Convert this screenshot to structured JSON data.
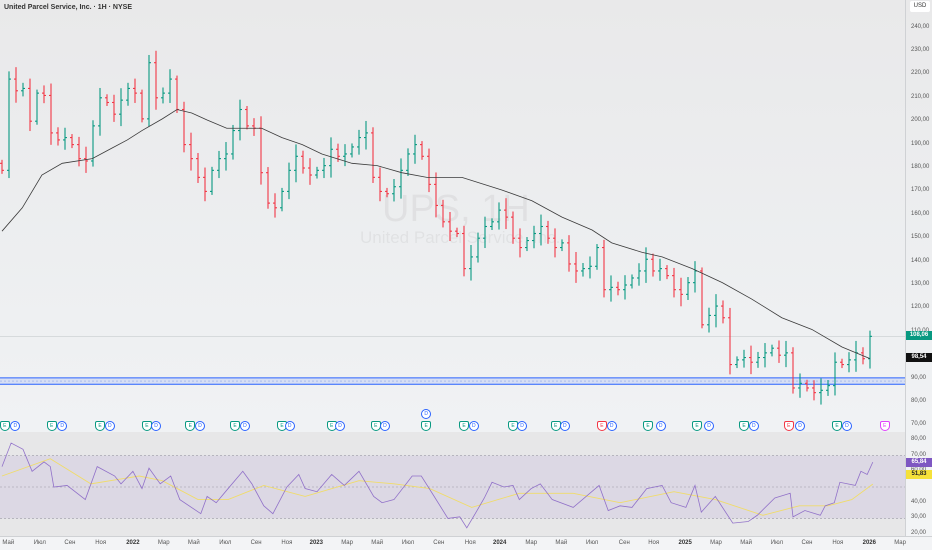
{
  "header": {
    "title": "United Parcel Service, Inc. · 1H · NYSE",
    "currency": "USD"
  },
  "watermark": {
    "symbol": "UPS, 1H",
    "name": "United Parcel Service, Inc."
  },
  "colors": {
    "up": "#089981",
    "down": "#f23645",
    "ma": "#3a3a3a",
    "rsi": "#7e57c2",
    "rsi_ma": "#f0dc6a",
    "zone": "#2962ff",
    "last_price_bg": "#089981",
    "ma_price_bg": "#111111",
    "rsi_label_bg": "#7e57c2",
    "rsi_ma_label_bg": "#f5e13a"
  },
  "price_axis": {
    "ticks": [
      "240,00",
      "230,00",
      "220,00",
      "210,00",
      "200,00",
      "190,00",
      "180,00",
      "170,00",
      "160,00",
      "150,00",
      "140,00",
      "130,00",
      "120,00",
      "110,00",
      "90,00",
      "80,00",
      "70,00"
    ],
    "tick_values": [
      240,
      230,
      220,
      210,
      200,
      190,
      180,
      170,
      160,
      150,
      140,
      130,
      120,
      110,
      90,
      80,
      70
    ],
    "last_price": "108,06",
    "ma_price": "98,54"
  },
  "rsi_axis": {
    "ticks": [
      "80,00",
      "70,00",
      "60,00",
      "40,00",
      "30,00",
      "20,00"
    ],
    "tick_values": [
      80,
      70,
      60,
      40,
      30,
      20
    ],
    "rsi_value": "65,84",
    "rsi_ma_value": "51,83"
  },
  "time_axis": {
    "labels": [
      {
        "t": 0.9,
        "text": "Май"
      },
      {
        "t": 5.4,
        "text": "Июл"
      },
      {
        "t": 9.7,
        "text": "Сен"
      },
      {
        "t": 14.1,
        "text": "Ноя"
      },
      {
        "t": 18.7,
        "text": "2022",
        "year": true
      },
      {
        "t": 23.1,
        "text": "Мар"
      },
      {
        "t": 27.4,
        "text": "Май"
      },
      {
        "t": 31.9,
        "text": "Июл"
      },
      {
        "t": 36.3,
        "text": "Сен"
      },
      {
        "t": 40.7,
        "text": "Ноя"
      },
      {
        "t": 44.9,
        "text": "2023",
        "year": true
      },
      {
        "t": 49.3,
        "text": "Мар"
      },
      {
        "t": 53.6,
        "text": "Май"
      },
      {
        "t": 58,
        "text": "Июл"
      },
      {
        "t": 62.4,
        "text": "Сен"
      },
      {
        "t": 66.9,
        "text": "Ноя"
      },
      {
        "t": 71.1,
        "text": "2024",
        "year": true
      },
      {
        "t": 75.6,
        "text": "Мар"
      },
      {
        "t": 79.9,
        "text": "Май"
      },
      {
        "t": 84.3,
        "text": "Июл"
      },
      {
        "t": 88.9,
        "text": "Сен"
      },
      {
        "t": 93.1,
        "text": "Ноя"
      },
      {
        "t": 97.6,
        "text": "2025",
        "year": true
      },
      {
        "t": 102,
        "text": "Мар"
      },
      {
        "t": 106.3,
        "text": "Май"
      },
      {
        "t": 110.7,
        "text": "Июл"
      },
      {
        "t": 115,
        "text": "Сен"
      },
      {
        "t": 119.4,
        "text": "Ноя"
      },
      {
        "t": 123.9,
        "text": "2026",
        "year": true
      },
      {
        "t": 128.3,
        "text": "Мар"
      }
    ]
  },
  "events": {
    "earnings": [
      {
        "t": 0.4
      },
      {
        "t": 7.1
      },
      {
        "t": 14
      },
      {
        "t": 20.7
      },
      {
        "t": 26.9
      },
      {
        "t": 33.3
      },
      {
        "t": 40
      },
      {
        "t": 47.1
      },
      {
        "t": 53.4
      },
      {
        "t": 60.6
      },
      {
        "t": 66
      },
      {
        "t": 73
      },
      {
        "t": 79.1
      },
      {
        "t": 85.7,
        "miss": true
      },
      {
        "t": 92.3
      },
      {
        "t": 99.3
      },
      {
        "t": 106
      },
      {
        "t": 112.4,
        "miss": true
      },
      {
        "t": 119.3
      },
      {
        "t": 126.1,
        "future": true
      }
    ],
    "dividends": [
      {
        "t": 1.9
      },
      {
        "t": 8.6
      },
      {
        "t": 15.4
      },
      {
        "t": 22
      },
      {
        "t": 28.3
      },
      {
        "t": 34.7
      },
      {
        "t": 41.1
      },
      {
        "t": 48.3
      },
      {
        "t": 54.7
      },
      {
        "t": 60.6,
        "upper": true
      },
      {
        "t": 67.4
      },
      {
        "t": 74.3
      },
      {
        "t": 80.4
      },
      {
        "t": 87.1
      },
      {
        "t": 94.1
      },
      {
        "t": 101
      },
      {
        "t": 107.4
      },
      {
        "t": 114
      },
      {
        "t": 120.7
      }
    ],
    "earnings_letter": "E",
    "dividend_letter": "D"
  },
  "chart_data": {
    "type": "ohlc",
    "title": "United Parcel Service, Inc. · 1H · NYSE",
    "ylim": [
      65,
      245
    ],
    "closes": [
      179,
      218,
      213,
      214,
      200,
      212,
      211,
      195,
      192,
      193,
      190,
      184,
      183,
      198,
      210,
      208,
      203,
      209,
      214,
      212,
      201,
      225,
      210,
      212,
      218,
      205,
      190,
      184,
      176,
      170,
      179,
      184,
      186,
      196,
      205,
      198,
      197,
      178,
      165,
      163,
      170,
      179,
      185,
      180,
      177,
      179,
      181,
      188,
      185,
      186,
      189,
      193,
      195,
      176,
      170,
      169,
      172,
      179,
      186,
      190,
      185,
      173,
      164,
      157,
      153,
      152,
      137,
      142,
      150,
      155,
      157,
      162,
      159,
      150,
      146,
      149,
      152,
      155,
      150,
      146,
      148,
      139,
      136,
      137,
      138,
      146,
      128,
      129,
      128,
      130,
      133,
      136,
      141,
      136,
      137,
      134,
      128,
      126,
      131,
      136,
      113,
      117,
      121,
      116,
      96,
      98,
      99,
      97,
      99,
      101,
      103,
      100,
      101,
      86,
      88,
      86,
      84,
      85,
      87,
      97,
      96,
      98,
      101,
      98.5,
      108.06
    ],
    "last_high": 110.5,
    "moving_average": [
      [
        0,
        153
      ],
      [
        2.9,
        163
      ],
      [
        5.7,
        177
      ],
      [
        8.6,
        182
      ],
      [
        12.9,
        184
      ],
      [
        15.7,
        188.5
      ],
      [
        17.9,
        192
      ],
      [
        20,
        196
      ],
      [
        22.9,
        201
      ],
      [
        25,
        205
      ],
      [
        27.1,
        203.5
      ],
      [
        29.3,
        200.5
      ],
      [
        32.1,
        197
      ],
      [
        37.1,
        197
      ],
      [
        40,
        193
      ],
      [
        42.9,
        190
      ],
      [
        45.7,
        186
      ],
      [
        50,
        182
      ],
      [
        53.6,
        181
      ],
      [
        57.1,
        178
      ],
      [
        60.7,
        176
      ],
      [
        65.7,
        176
      ],
      [
        71.4,
        170.6
      ],
      [
        75.7,
        166
      ],
      [
        80,
        159
      ],
      [
        84.3,
        153.5
      ],
      [
        87.1,
        148
      ],
      [
        91.4,
        144
      ],
      [
        94.3,
        142
      ],
      [
        98.6,
        137
      ],
      [
        102.9,
        131
      ],
      [
        107.1,
        124
      ],
      [
        111.4,
        116
      ],
      [
        115.7,
        111
      ],
      [
        120,
        103.5
      ],
      [
        124,
        98.54
      ]
    ],
    "support_zone": {
      "upper": 90.3,
      "lower": 87.6
    },
    "rsi": [
      [
        0,
        63
      ],
      [
        1.3,
        78
      ],
      [
        3,
        74
      ],
      [
        4.3,
        60
      ],
      [
        6,
        66
      ],
      [
        6.9,
        63
      ],
      [
        7.4,
        50
      ],
      [
        9.3,
        51
      ],
      [
        11.9,
        42
      ],
      [
        13.6,
        63
      ],
      [
        16.1,
        57
      ],
      [
        17,
        52
      ],
      [
        18.7,
        60
      ],
      [
        20,
        49
      ],
      [
        21,
        62
      ],
      [
        22.6,
        52
      ],
      [
        24.1,
        57
      ],
      [
        25.4,
        42
      ],
      [
        28.4,
        33
      ],
      [
        29.3,
        44
      ],
      [
        30.6,
        40
      ],
      [
        32.3,
        49
      ],
      [
        34.4,
        60
      ],
      [
        35.7,
        52
      ],
      [
        37.4,
        38
      ],
      [
        38.7,
        33
      ],
      [
        40.7,
        50
      ],
      [
        42.4,
        58
      ],
      [
        43.3,
        49
      ],
      [
        45,
        47
      ],
      [
        47.1,
        58
      ],
      [
        48.9,
        51
      ],
      [
        51,
        60
      ],
      [
        53.1,
        44
      ],
      [
        54.3,
        40
      ],
      [
        56,
        42
      ],
      [
        58.6,
        57
      ],
      [
        59.9,
        57
      ],
      [
        61.6,
        45
      ],
      [
        63.7,
        30
      ],
      [
        65.4,
        31
      ],
      [
        66.4,
        24
      ],
      [
        67.6,
        33
      ],
      [
        68.9,
        43
      ],
      [
        70,
        53
      ],
      [
        71.7,
        50
      ],
      [
        73,
        51
      ],
      [
        73.9,
        42
      ],
      [
        75.6,
        49
      ],
      [
        76.9,
        52
      ],
      [
        78.6,
        42
      ],
      [
        81.6,
        37
      ],
      [
        85.3,
        51
      ],
      [
        86.6,
        35
      ],
      [
        88.3,
        38
      ],
      [
        90,
        37
      ],
      [
        92.1,
        49
      ],
      [
        94.3,
        51
      ],
      [
        95.6,
        40
      ],
      [
        97.7,
        37
      ],
      [
        99,
        51
      ],
      [
        99.9,
        34
      ],
      [
        101.9,
        44
      ],
      [
        104.4,
        27
      ],
      [
        106.6,
        28
      ],
      [
        107.9,
        32
      ],
      [
        110.4,
        43
      ],
      [
        112.6,
        46
      ],
      [
        113,
        31
      ],
      [
        114.7,
        35
      ],
      [
        116.9,
        32
      ],
      [
        117.6,
        38
      ],
      [
        118.9,
        40
      ],
      [
        119.7,
        53
      ],
      [
        121.9,
        51
      ],
      [
        122.7,
        60
      ],
      [
        123.6,
        58
      ],
      [
        124.4,
        65.84
      ]
    ],
    "rsi_ma": [
      [
        0,
        57
      ],
      [
        6.9,
        68
      ],
      [
        12.7,
        52
      ],
      [
        19.6,
        57
      ],
      [
        22.9,
        54
      ],
      [
        28,
        42
      ],
      [
        32.3,
        42
      ],
      [
        37.4,
        51
      ],
      [
        43.3,
        44
      ],
      [
        51,
        54
      ],
      [
        56,
        52
      ],
      [
        61.1,
        49
      ],
      [
        67.1,
        37
      ],
      [
        73.9,
        46
      ],
      [
        81.6,
        46
      ],
      [
        88.3,
        40
      ],
      [
        96,
        47
      ],
      [
        101.9,
        42
      ],
      [
        108.7,
        32
      ],
      [
        113.9,
        38
      ],
      [
        118,
        38
      ],
      [
        121.4,
        42
      ],
      [
        124.4,
        51.83
      ]
    ],
    "rsi_levels": [
      70,
      50,
      30
    ]
  }
}
